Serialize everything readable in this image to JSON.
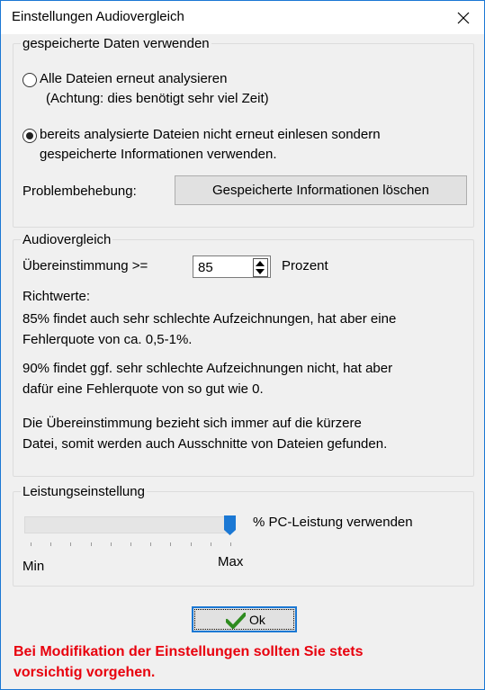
{
  "window": {
    "title": "Einstellungen Audiovergleich"
  },
  "stored_data": {
    "legend": "gespeicherte Daten verwenden",
    "option_all": {
      "line1": "Alle Dateien erneut analysieren",
      "line2": "(Achtung: dies benötigt sehr viel Zeit)",
      "selected": false
    },
    "option_reuse": {
      "line1": "bereits analysierte Dateien nicht erneut einlesen sondern",
      "line2": "gespeicherte Informationen verwenden.",
      "selected": true
    },
    "troubleshoot_label": "Problembehebung:",
    "delete_button": "Gespeicherte Informationen löschen"
  },
  "audio_compare": {
    "legend": "Audiovergleich",
    "match_label": "Übereinstimmung >=",
    "match_value": "85",
    "unit": "Prozent",
    "guide_title": "Richtwerte:",
    "para1_line1": "85% findet auch sehr schlechte Aufzeichnungen, hat aber eine",
    "para1_line2": "Fehlerquote von ca. 0,5-1%.",
    "para2_line1": "90% findet ggf. sehr schlechte Aufzeichnungen nicht, hat aber",
    "para2_line2": "dafür eine Fehlerquote von so gut wie 0.",
    "para3_line1": "Die Übereinstimmung bezieht sich immer auf die kürzere",
    "para3_line2": "Datei, somit werden auch Ausschnitte von Dateien gefunden."
  },
  "performance": {
    "legend": "Leistungseinstellung",
    "slider_label": "% PC-Leistung verwenden",
    "min_label": "Min",
    "max_label": "Max",
    "slider_level": 1.0
  },
  "ok_button": "Ok",
  "warning": {
    "line1": "Bei Modifikation der Einstellungen sollten Sie stets",
    "line2": "vorsichtig vorgehen."
  },
  "colors": {
    "accent": "#1b78d4",
    "warning": "#e8000d",
    "thumb": "#1b78d4",
    "check": "#2e8b1f"
  },
  "icons": {
    "close": "close-icon",
    "check": "check-icon"
  }
}
